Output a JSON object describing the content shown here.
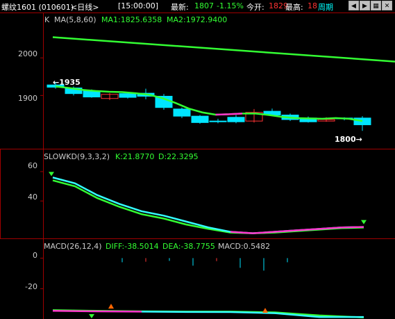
{
  "topbar": {
    "symbol": "螺纹1601 (010601)",
    "period": "<日线>",
    "time": "[15:00:00]",
    "latest_label": "最新:",
    "latest_value": "1807",
    "change": "-1.15%",
    "open_label": "今开:",
    "open_value": "1829",
    "high_label": "最高:",
    "high_value": "18",
    "cycle_label": "周期",
    "nav_icons": [
      "arrow-left-icon",
      "arrow-right-icon",
      "grid-icon",
      "close-icon"
    ]
  },
  "main_panel": {
    "type_label": "K",
    "ma_title": "MA(5,8,60)",
    "ma1_label": "MA1:1825.6358",
    "ma2_label": "MA2:1972.9400",
    "y_labels": [
      "2000",
      "1900"
    ],
    "high_annot": "1935",
    "low_annot": "1800"
  },
  "kd_panel": {
    "title": "SLOWKD(9,3,3,2)",
    "k_label": "K:21.8770",
    "d_label": "D:22.3295",
    "y_labels": [
      "60",
      "40"
    ]
  },
  "macd_panel": {
    "title": "MACD(26,12,4)",
    "diff_label": "DIFF:-38.5014",
    "dea_label": "DEA:-38.7755",
    "macd_label": "MACD:0.5482",
    "y_labels": [
      "0",
      "-20"
    ]
  },
  "colors": {
    "up": "#ff3333",
    "down": "#00e5ff",
    "ma_line": "#33ff33",
    "k_line": "#33ffff",
    "d_line": "#33ff33",
    "macd_pink": "#ff33cc",
    "border": "#a00000"
  },
  "chart_data": {
    "type": "candlestick",
    "ylim": [
      1775,
      2080
    ],
    "ma_long": {
      "x0": 1,
      "x1": 25,
      "y0": 2055,
      "y1": 1973
    },
    "ma_short": [
      1924,
      1920,
      1915,
      1912,
      1910,
      1909,
      1906,
      1902,
      1893,
      1880,
      1865,
      1855,
      1849,
      1850,
      1852,
      1852,
      1848,
      1843,
      1840,
      1839,
      1838,
      1840,
      1838,
      1832
    ],
    "candles": [
      {
        "o": 1928,
        "c": 1922,
        "h": 1935,
        "l": 1918
      },
      {
        "o": 1920,
        "c": 1905,
        "h": 1924,
        "l": 1900
      },
      {
        "o": 1912,
        "c": 1896,
        "h": 1916,
        "l": 1894
      },
      {
        "o": 1892,
        "c": 1903,
        "h": 1906,
        "l": 1888
      },
      {
        "o": 1905,
        "c": 1895,
        "h": 1910,
        "l": 1892
      },
      {
        "o": 1906,
        "c": 1898,
        "h": 1918,
        "l": 1890
      },
      {
        "o": 1898,
        "c": 1868,
        "h": 1904,
        "l": 1862
      },
      {
        "o": 1864,
        "c": 1845,
        "h": 1868,
        "l": 1840
      },
      {
        "o": 1845,
        "c": 1828,
        "h": 1848,
        "l": 1825
      },
      {
        "o": 1832,
        "c": 1830,
        "h": 1838,
        "l": 1826
      },
      {
        "o": 1842,
        "c": 1830,
        "h": 1848,
        "l": 1826
      },
      {
        "o": 1832,
        "c": 1855,
        "h": 1864,
        "l": 1828
      },
      {
        "o": 1858,
        "c": 1848,
        "h": 1865,
        "l": 1845
      },
      {
        "o": 1848,
        "c": 1836,
        "h": 1852,
        "l": 1832
      },
      {
        "o": 1840,
        "c": 1830,
        "h": 1844,
        "l": 1828
      },
      {
        "o": 1832,
        "c": 1836,
        "h": 1842,
        "l": 1830
      },
      {
        "o": 1840,
        "c": 1838,
        "h": 1842,
        "l": 1834
      },
      {
        "o": 1840,
        "c": 1822,
        "h": 1845,
        "l": 1806
      }
    ],
    "kd": {
      "ylim": [
        15,
        68
      ],
      "k": [
        56,
        52,
        44,
        38,
        33,
        30,
        26,
        22,
        19,
        18,
        19,
        20,
        21,
        22,
        22.3
      ],
      "d": [
        54,
        50,
        42,
        36,
        31,
        28,
        24,
        21,
        18.5,
        18,
        18.5,
        19.5,
        20.5,
        21.5,
        21.9
      ]
    },
    "macd": {
      "ylim": [
        -38,
        2
      ],
      "diff": [
        -34.5,
        -34.8,
        -35,
        -35.2,
        -35.3,
        -36,
        -38.5,
        -38.5
      ],
      "dea": [
        -34,
        -34.5,
        -34.8,
        -35,
        -35,
        -35.5,
        -37.5,
        -38.8
      ],
      "bars": [
        -1,
        0.8,
        -0.5,
        -2.2,
        0.6,
        -3,
        -4,
        -1
      ]
    }
  }
}
